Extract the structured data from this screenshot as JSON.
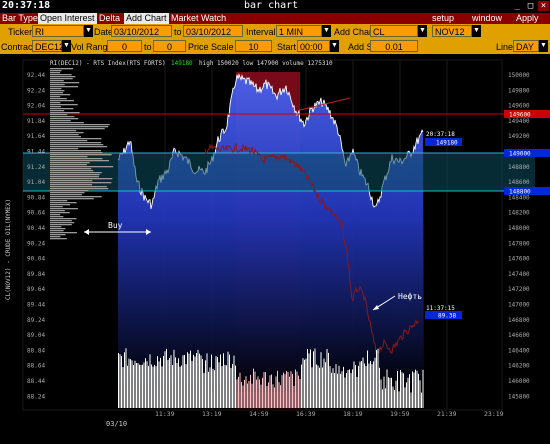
{
  "window": {
    "time": "20:37:18",
    "title": "bar chart",
    "buttons": [
      "_",
      "□",
      "×"
    ]
  },
  "menu": {
    "bar_type": "Bar Type",
    "open_interest": "Open Interest",
    "delta": "Delta",
    "add_chart": "Add Chart",
    "market_watch": "Market Watch",
    "setup": "setup",
    "window": "window",
    "apply": "Apply"
  },
  "row1": {
    "ticker_label": "Ticker",
    "ticker": "RI",
    "date_label": "Date",
    "date_from": "03/10/2012",
    "to_label": "to",
    "date_to": "03/10/2012",
    "interval_label": "Interval",
    "interval": "1 MIN",
    "add_chart_label": "Add Chart",
    "add_chart": "CL",
    "contract2": "NOV12"
  },
  "row2": {
    "contract_label": "Contract",
    "contract": "DEC12",
    "vol_range_label": "Vol Range",
    "vol_from": "0",
    "to_label": "to",
    "vol_to": "0",
    "price_scale_label": "Price Scale",
    "price_scale": "10",
    "start_label": "Start",
    "start": "00:00",
    "add_scale_label": "Add Scale",
    "add_scale": "0.01",
    "line_label": "Line",
    "line": "DAY"
  },
  "chart": {
    "header_symbol": "RI(DEC12) - RTS Index(RTS FORTS)",
    "header_last": "149180",
    "header_stats": "high 150020  low 147900  volume 1275310",
    "left_axis_title": "CL(NOV12) - CRUDE OIL(NYMEX)",
    "right_ticks": [
      "150000",
      "149800",
      "149600",
      "149400",
      "149200",
      "149000",
      "148800",
      "148600",
      "148400",
      "148200",
      "148000",
      "147800",
      "147600",
      "147400",
      "147200",
      "147000",
      "146800",
      "146600",
      "146400",
      "146200",
      "146000",
      "145800"
    ],
    "left_ticks": [
      "92.44",
      "92.24",
      "92.04",
      "91.84",
      "91.64",
      "91.44",
      "91.24",
      "91.04",
      "90.84",
      "90.64",
      "90.44",
      "90.24",
      "90.04",
      "89.84",
      "89.64",
      "89.44",
      "89.24",
      "89.04",
      "88.84",
      "88.64",
      "88.44",
      "88.24"
    ],
    "x_ticks": [
      "11:39",
      "13:19",
      "14:59",
      "16:39",
      "18:19",
      "19:59",
      "21:39",
      "23:19"
    ],
    "date_label": "03/10",
    "annotation_buy": "Buy",
    "annotation_oil": "Нефть",
    "label_rts_time": "20:37:18",
    "label_rts_price": "149180",
    "label_oil_time": "11:37:15",
    "label_oil_price": "89.38",
    "level_high": "149600",
    "level_mid": "149000",
    "level_low": "148800"
  },
  "colors": {
    "menubar": "#8a0000",
    "toolbar": "#e0a000",
    "field": "#f79d00",
    "price_fill_top": "#3c54e6",
    "highlight_red": "#6b0a14",
    "band_teal": "#0c4f5e",
    "oil_line": "#8a1818",
    "level_red": "#cc0000",
    "level_blue": "#0028d8"
  }
}
